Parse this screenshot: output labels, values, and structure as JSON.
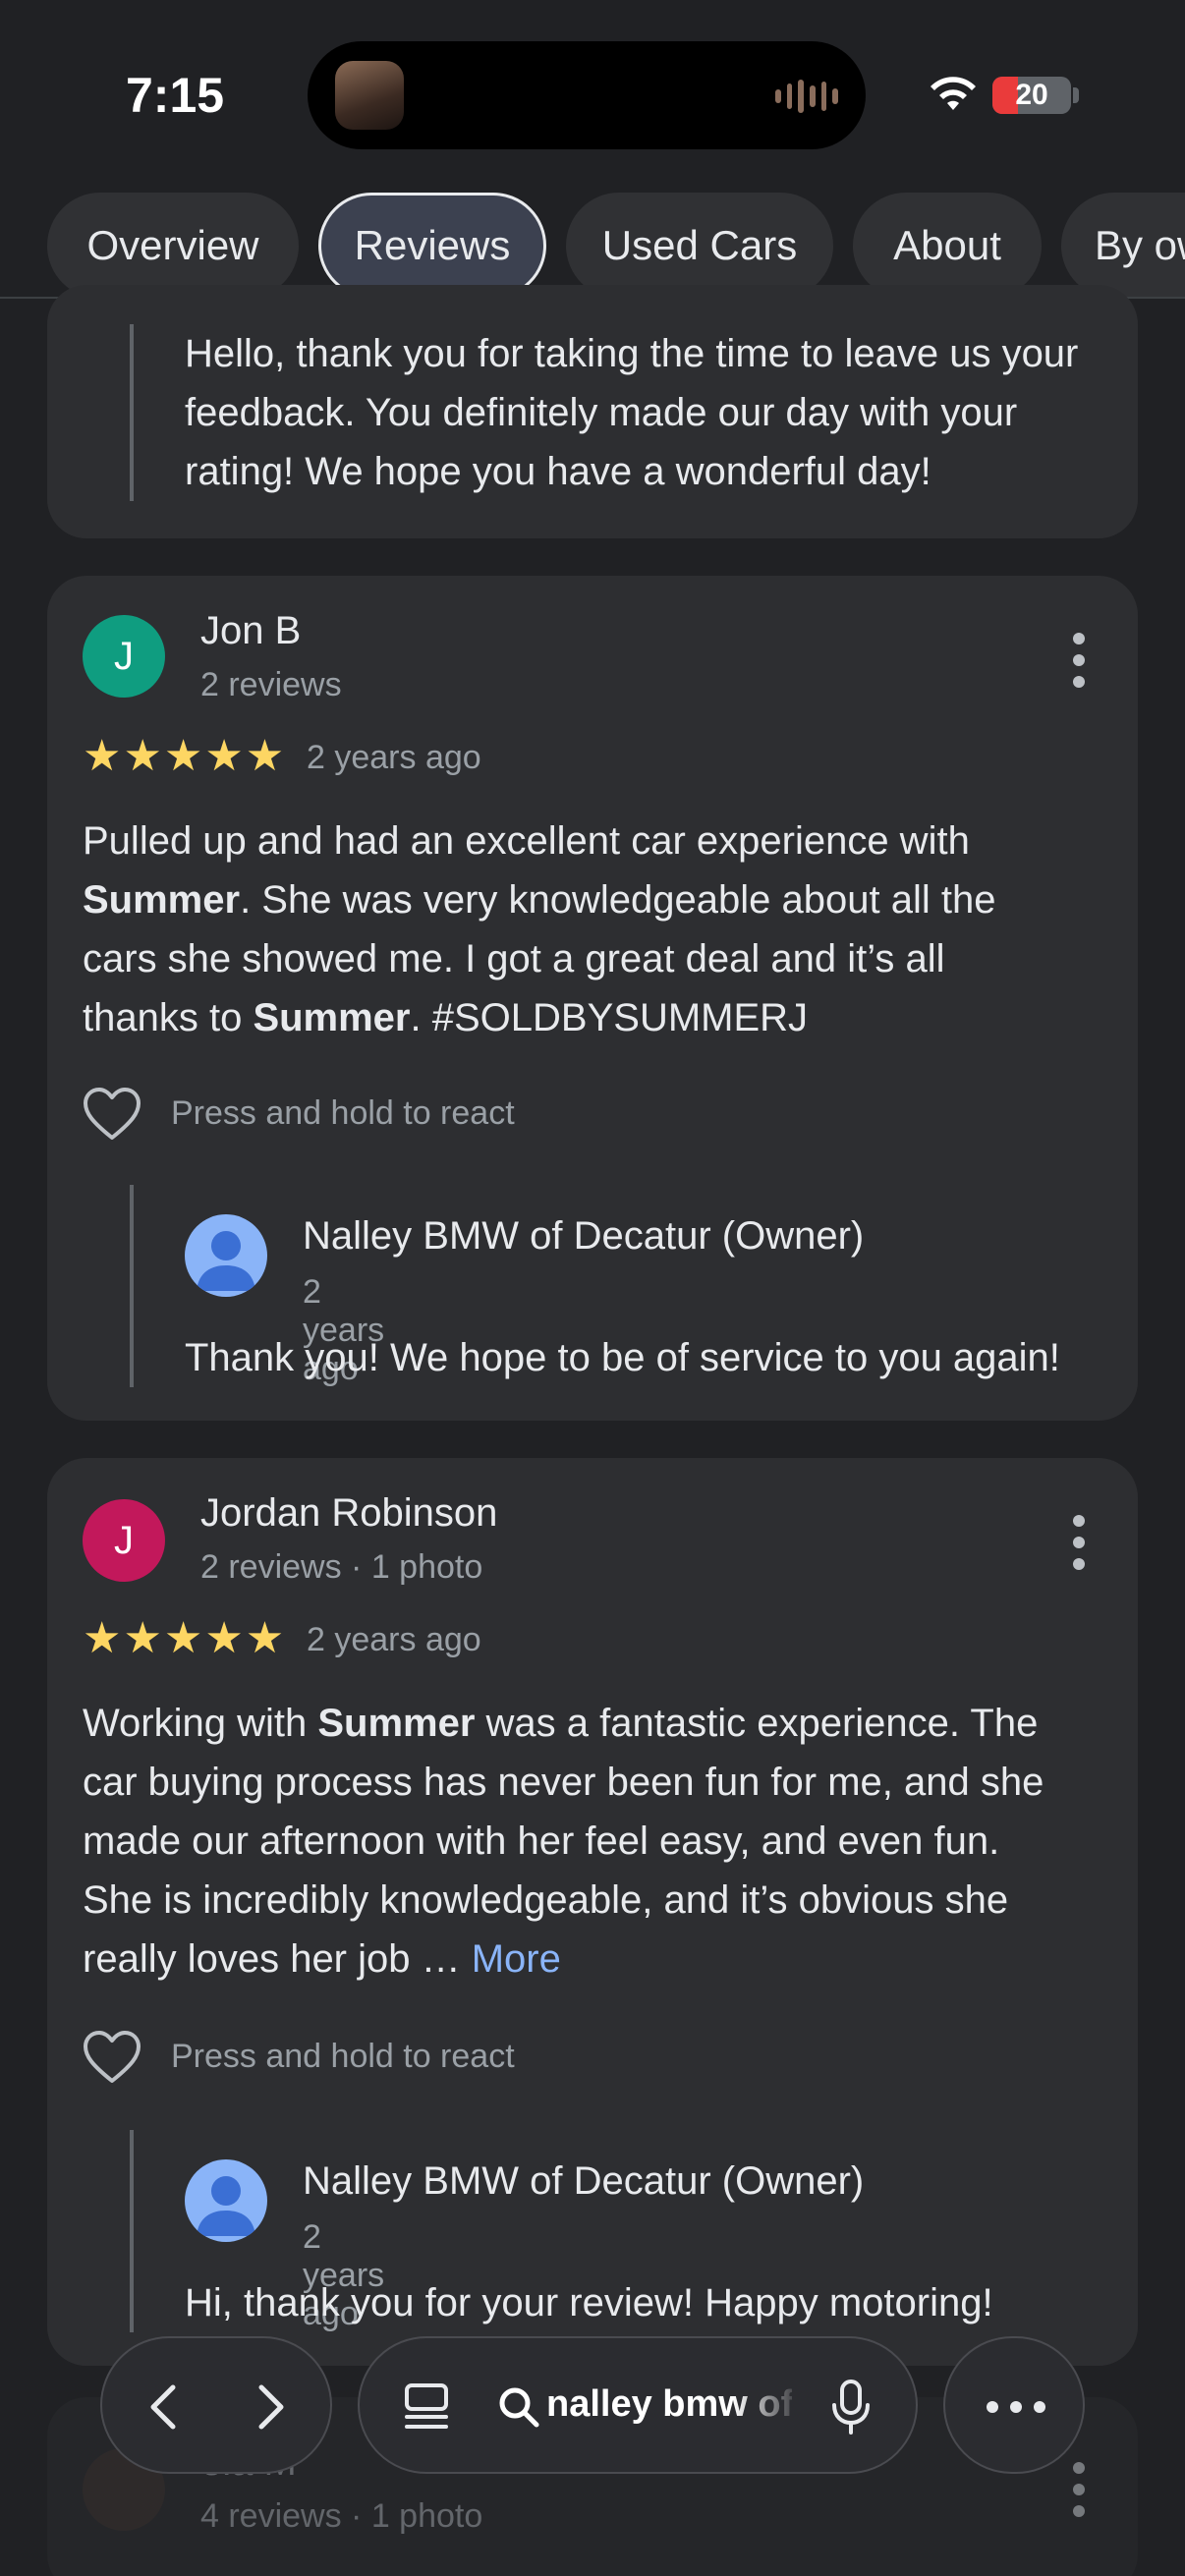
{
  "status_bar": {
    "time": "7:15",
    "battery": "20"
  },
  "tabs": [
    {
      "label": "Overview"
    },
    {
      "label": "Reviews"
    },
    {
      "label": "Used Cars"
    },
    {
      "label": "About"
    },
    {
      "label": "By ow"
    }
  ],
  "active_tab": "Reviews",
  "previous_reply": {
    "text_lines": [
      "Hello, thank you for taking the time to leave us your",
      "feedback. You definitely made our day with your",
      "rating! We hope you have a wonderful day!"
    ]
  },
  "reviews": [
    {
      "avatar_letter": "J",
      "avatar_color": "#0f9d80",
      "author": "Jon B",
      "meta": "2 reviews",
      "rating": 5,
      "stars": "★★★★★",
      "age": "2 years ago",
      "body": {
        "l1": "Pulled up and had an excellent car experience with",
        "l2_bold": "Summer",
        "l2_rest": ". She was very knowledgeable about all the",
        "l3": "cars she showed me. I got a great deal and it’s all",
        "l4_pre": "thanks to ",
        "l4_bold": "Summer",
        "l4_rest": ". #SOLDBYSUMMERJ"
      },
      "react_label": "Press and hold to react",
      "owner_reply": {
        "name": "Nalley BMW of Decatur (Owner)",
        "age": "2 years ago",
        "text": "Thank you! We hope to be of service to you again!"
      }
    },
    {
      "avatar_letter": "J",
      "avatar_color": "#c2185b",
      "author": "Jordan Robinson",
      "meta": "2 reviews · 1 photo",
      "rating": 5,
      "stars": "★★★★★",
      "age": "2 years ago",
      "body": {
        "l1_pre": "Working with ",
        "l1_bold": "Summer",
        "l1_rest": " was a fantastic experience. The",
        "l2": "car buying process has never been fun for me, and she",
        "l3": "made our afternoon with her feel easy, and even fun.",
        "l4": "She is incredibly knowledgeable, and it’s obvious she",
        "l5": "really loves her job … ",
        "more": "More"
      },
      "react_label": "Press and hold to react",
      "owner_reply": {
        "name": "Nalley BMW of Decatur (Owner)",
        "age": "2 years ago",
        "text": "Hi, thank you for your review! Happy motoring!"
      }
    }
  ],
  "next_review_peek": {
    "author_partial": "ela M",
    "meta": "4 reviews · 1 photo"
  },
  "bottom_bar": {
    "search_text": "nalley bmw of"
  },
  "colors": {
    "background": "#202124",
    "card": "#2d2e31",
    "star": "#fdd663",
    "link": "#8ab4f8",
    "battery_low": "#ea3b3b"
  }
}
